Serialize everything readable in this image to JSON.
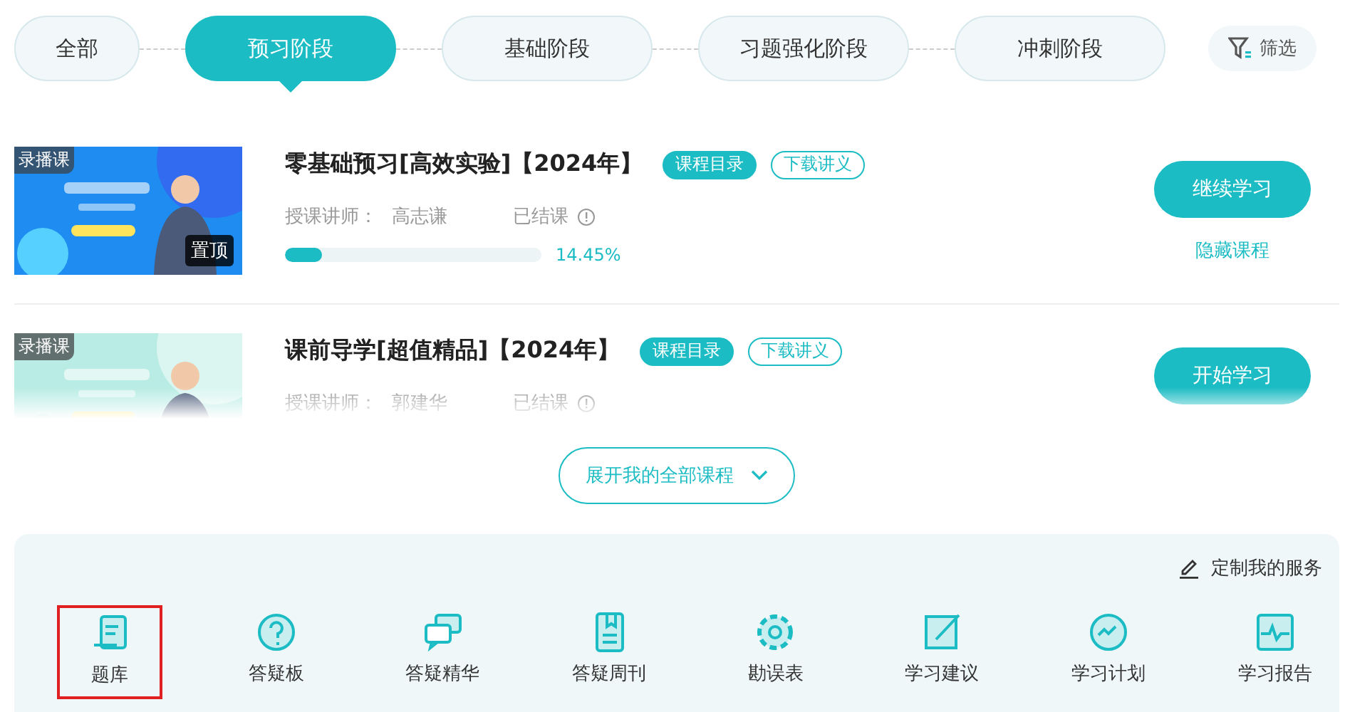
{
  "stages": [
    {
      "label": "全部",
      "selected": false
    },
    {
      "label": "预习阶段",
      "selected": true
    },
    {
      "label": "基础阶段",
      "selected": false
    },
    {
      "label": "习题强化阶段",
      "selected": false
    },
    {
      "label": "冲刺阶段",
      "selected": false
    }
  ],
  "filter": {
    "label": "筛选"
  },
  "courses": [
    {
      "badge": "录播课",
      "pinned_label": "置顶",
      "title": "零基础预习[高效实验]【2024年】",
      "tags": [
        {
          "label": "课程目录",
          "kind": "filled"
        },
        {
          "label": "下载讲义",
          "kind": "outline"
        }
      ],
      "teacher_label": "授课讲师：",
      "teacher": "高志谦",
      "status": "已结课",
      "progress": {
        "level": 0.1445,
        "reading": "14.45%"
      },
      "action": "继续学习",
      "hide": "隐藏课程",
      "cut_off": false
    },
    {
      "badge": "录播课",
      "title": "课前导学[超值精品]【2024年】",
      "tags": [
        {
          "label": "课程目录",
          "kind": "filled"
        },
        {
          "label": "下载讲义",
          "kind": "outline"
        }
      ],
      "teacher_label": "授课讲师：",
      "teacher": "郭建华",
      "status": "已结课",
      "action": "开始学习",
      "cut_off": true
    }
  ],
  "expand": {
    "label": "展开我的全部课程"
  },
  "services": {
    "customize": "定制我的服务",
    "items": [
      {
        "label": "题库",
        "kind": "bank",
        "selected": true
      },
      {
        "label": "答疑板",
        "kind": "question",
        "selected": false
      },
      {
        "label": "答疑精华",
        "kind": "chat",
        "selected": false
      },
      {
        "label": "答疑周刊",
        "kind": "book",
        "selected": false
      },
      {
        "label": "勘误表",
        "kind": "gear",
        "selected": false
      },
      {
        "label": "学习建议",
        "kind": "edit",
        "selected": false
      },
      {
        "label": "学习计划",
        "kind": "plan",
        "selected": false
      },
      {
        "label": "学习报告",
        "kind": "report",
        "selected": false
      }
    ]
  }
}
